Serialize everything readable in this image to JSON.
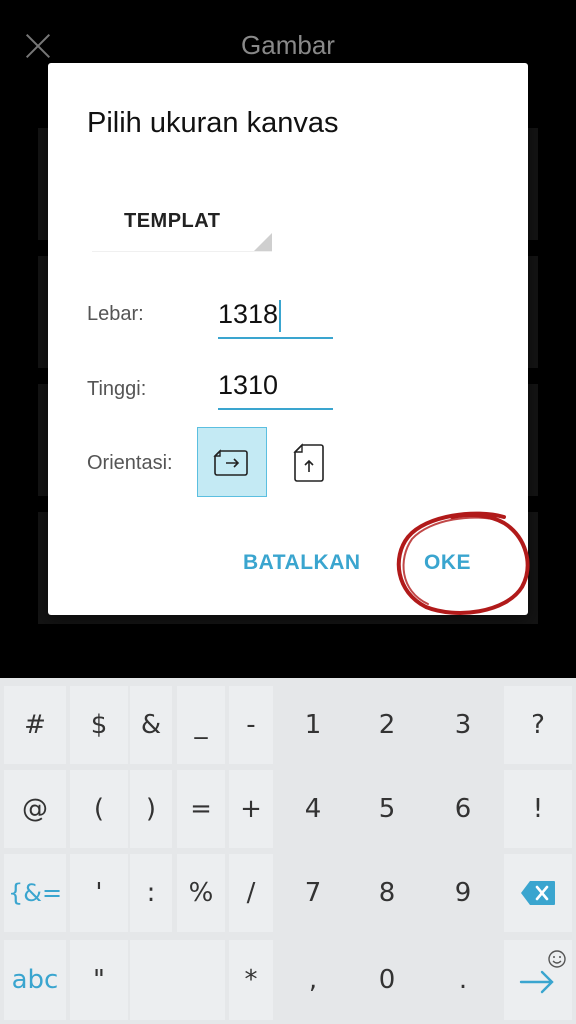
{
  "app": {
    "title": "Gambar"
  },
  "dialog": {
    "title": "Pilih ukuran kanvas",
    "template_label": "TEMPLAT",
    "width_label": "Lebar:",
    "width_value": "1318",
    "height_label": "Tinggi:",
    "height_value": "1310",
    "orientation_label": "Orientasi:",
    "cancel_label": "BATALKAN",
    "ok_label": "OKE"
  },
  "colors": {
    "accent": "#3aa5cf",
    "annotation": "#b11a1a",
    "keyboard_bg": "#e5e7e9"
  },
  "keyboard": {
    "row1": [
      "#",
      "$",
      "&",
      "_",
      "-",
      "1",
      "2",
      "3",
      "?"
    ],
    "row2": [
      "@",
      "(",
      ")",
      "=",
      "+",
      "4",
      "5",
      "6",
      "!"
    ],
    "row3": [
      "{&=",
      "'",
      ":",
      "%",
      "/",
      "7",
      "8",
      "9"
    ],
    "row4": [
      "abc",
      "\"",
      "*",
      ",",
      "0",
      "."
    ]
  }
}
